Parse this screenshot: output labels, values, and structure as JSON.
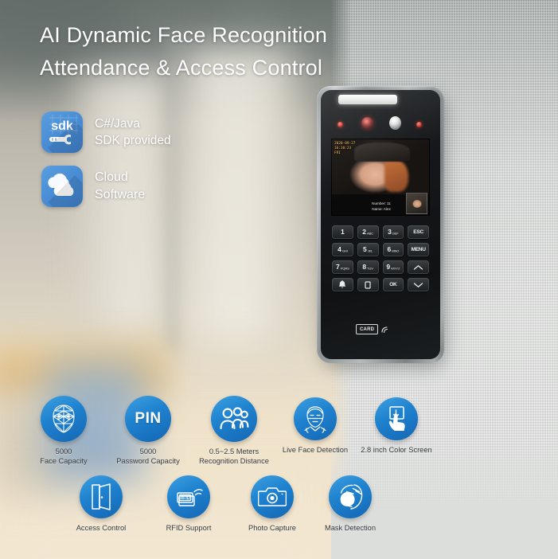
{
  "headline": "AI Dynamic Face Recognition\nAttendance & Access Control",
  "software_badges": [
    {
      "icon": "sdk-icon",
      "text": "C#/Java\nSDK provided"
    },
    {
      "icon": "cloud-icon",
      "text": "Cloud\nSoftware"
    }
  ],
  "device": {
    "screen": {
      "osd_time": "2020-09-27\n16:30:23\nFRI",
      "info": "Number: 11\nName: Alex"
    },
    "keys": [
      {
        "num": "1",
        "sub": ""
      },
      {
        "num": "2",
        "sub": "ABC"
      },
      {
        "num": "3",
        "sub": "DEF"
      },
      {
        "num": "ESC",
        "sub": "",
        "type": "label"
      },
      {
        "num": "4",
        "sub": "GHI"
      },
      {
        "num": "5",
        "sub": "JKL"
      },
      {
        "num": "6",
        "sub": "MNO"
      },
      {
        "num": "MENU",
        "sub": "",
        "type": "label"
      },
      {
        "num": "7",
        "sub": "PQRS"
      },
      {
        "num": "8",
        "sub": "TUV"
      },
      {
        "num": "9",
        "sub": "WXYZ"
      },
      {
        "num": "",
        "sub": "",
        "type": "up-arrow"
      },
      {
        "num": "",
        "sub": "",
        "type": "bell"
      },
      {
        "num": "0",
        "sub": "",
        "type": "zero-box"
      },
      {
        "num": "OK",
        "sub": "",
        "type": "label"
      },
      {
        "num": "",
        "sub": "",
        "type": "down-arrow"
      }
    ],
    "card_reader_label": "CARD"
  },
  "features_row1": [
    {
      "icon": "face-mesh-icon",
      "label": "5000\nFace Capacity"
    },
    {
      "icon": "pin-icon",
      "label": "5000\nPassword Capacity"
    },
    {
      "icon": "people-group-icon",
      "label": "0.5~2.5 Meters\nRecognition Distance"
    },
    {
      "icon": "live-face-icon",
      "label": "Live Face Detection"
    },
    {
      "icon": "touch-screen-icon",
      "label": "2.8 inch Color Screen"
    }
  ],
  "features_row2": [
    {
      "icon": "door-icon",
      "label": "Access Control"
    },
    {
      "icon": "rfid-card-icon",
      "label": "RFID Support"
    },
    {
      "icon": "camera-icon",
      "label": "Photo Capture"
    },
    {
      "icon": "mask-face-icon",
      "label": "Mask Detection"
    }
  ],
  "colors": {
    "accent_blue_light": "#3ea0e0",
    "accent_blue_dark": "#1467b4",
    "badge_blue": "#4a8ed5",
    "headline_text": "#ffffff",
    "label_text": "#35393c"
  }
}
